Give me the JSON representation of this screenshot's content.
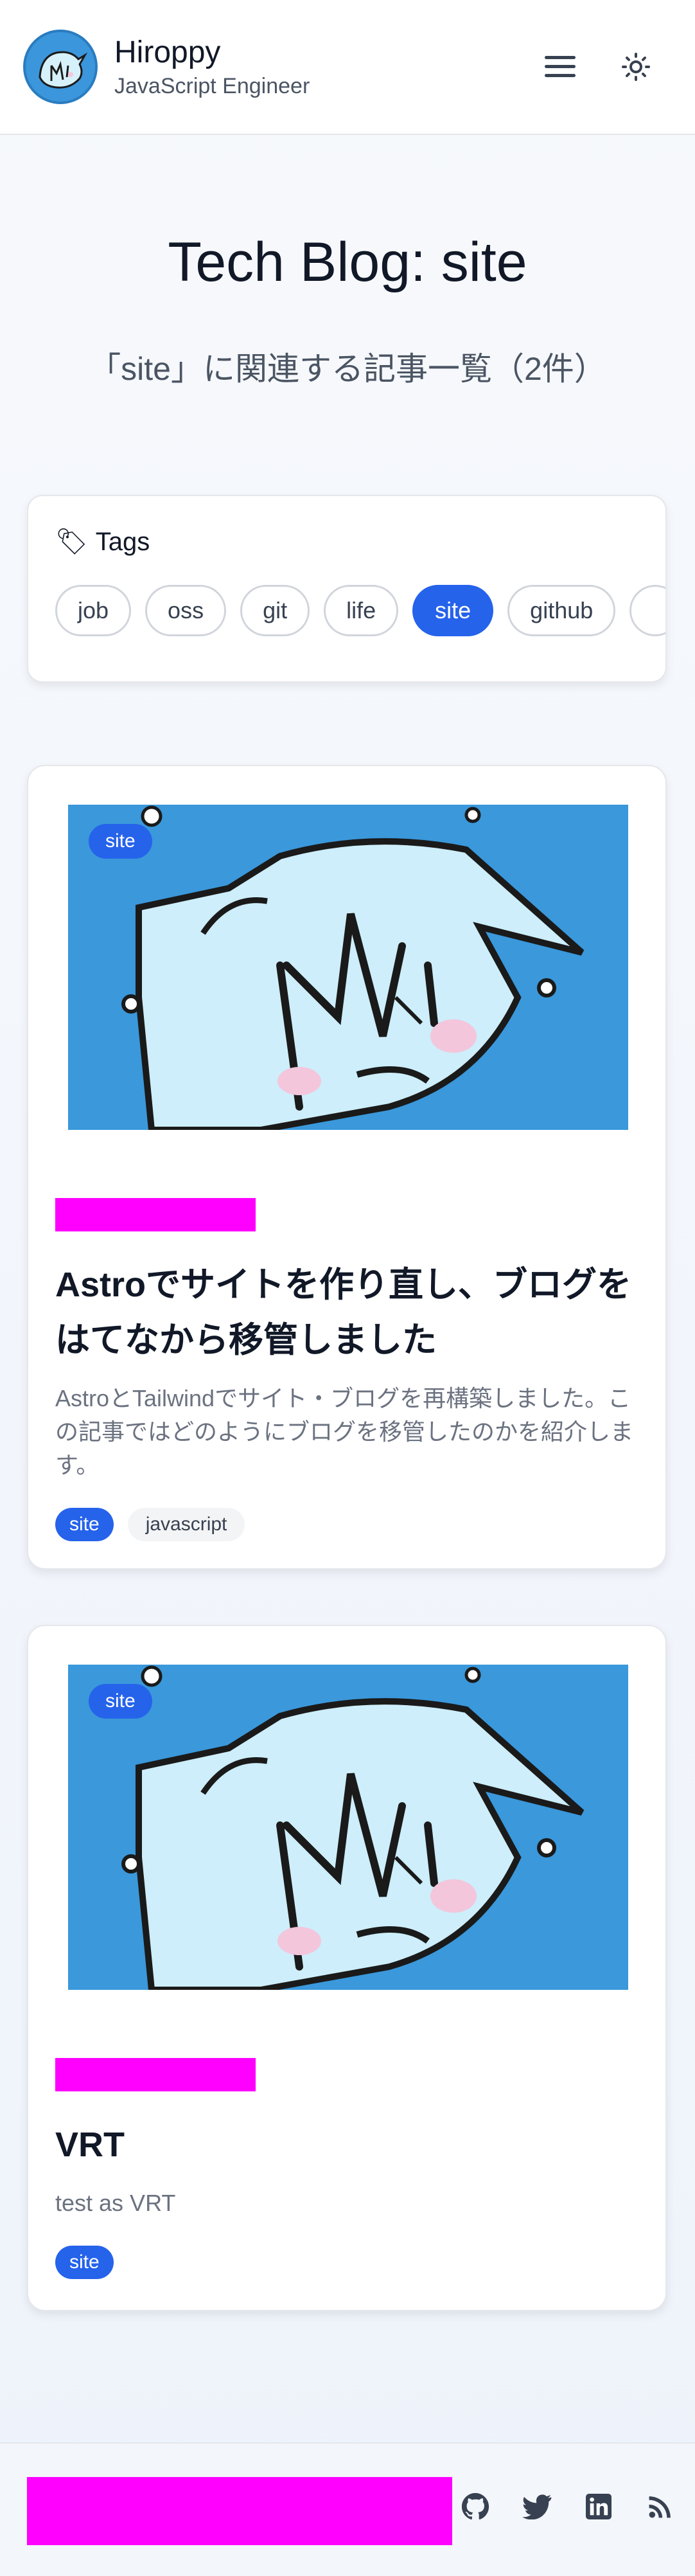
{
  "header": {
    "brand_name": "Hiroppy",
    "brand_subtitle": "JavaScript Engineer",
    "icons": [
      "avatar",
      "menu-icon",
      "theme-toggle-icon"
    ]
  },
  "hero": {
    "title": "Tech Blog: site",
    "subtitle": "「site」に関連する記事一覧（2件）"
  },
  "tags_section": {
    "heading": "Tags",
    "heading_icon": "🏷",
    "tags": [
      "job",
      "oss",
      "git",
      "life",
      "site",
      "github"
    ],
    "active_tag": "site"
  },
  "posts": [
    {
      "badge": "site",
      "title": "Astroでサイトを作り直し、ブログをはてなから移管しました",
      "description": "AstroとTailwindでサイト・ブログを再構築しました。この記事ではどのようにブログを移管したのかを紹介します。",
      "tags": [
        "site",
        "javascript"
      ]
    },
    {
      "badge": "site",
      "title": "VRT",
      "description": "test as VRT",
      "tags": [
        "site"
      ]
    }
  ],
  "footer": {
    "icons": [
      "github-icon",
      "twitter-icon",
      "linkedin-icon",
      "rss-icon"
    ]
  },
  "colors": {
    "accent": "#2563eb",
    "thumbnail_bg": "#3a98db",
    "redaction": "#ff00ff"
  }
}
